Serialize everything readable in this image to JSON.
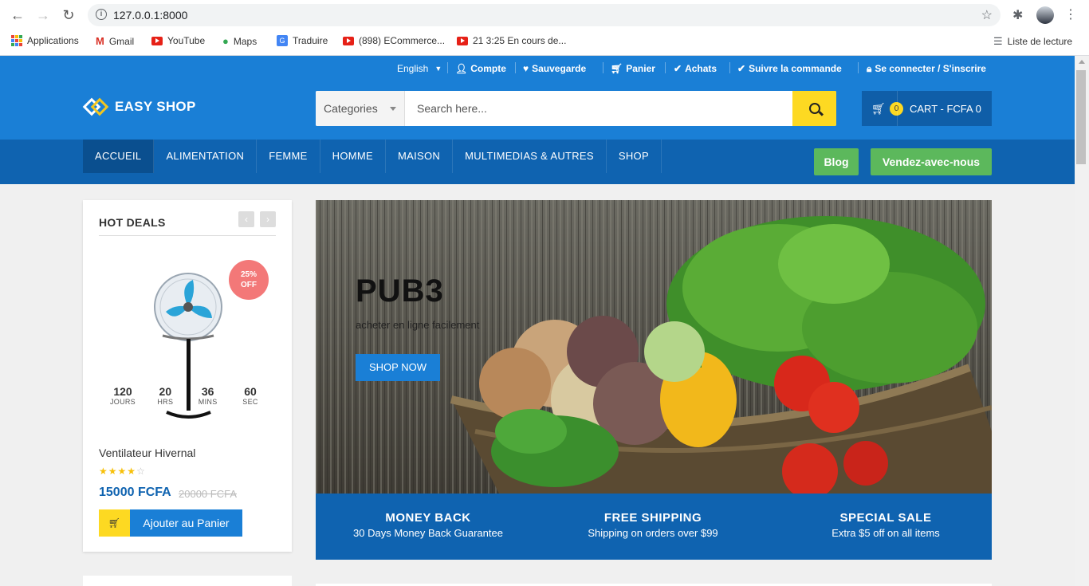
{
  "browser": {
    "url": "127.0.0.1:8000",
    "bookmarks": [
      {
        "label": "Applications"
      },
      {
        "label": "Gmail"
      },
      {
        "label": "YouTube"
      },
      {
        "label": "Maps"
      },
      {
        "label": "Traduire"
      },
      {
        "label": "(898) ECommerce..."
      },
      {
        "label": "21 3:25 En cours de..."
      }
    ],
    "reading_list": "Liste de lecture"
  },
  "topbar": {
    "language": "English",
    "links": [
      "Compte",
      "Sauvegarde",
      "Panier",
      "Achats",
      "Suivre la commande",
      "Se connecter / S'inscrire"
    ]
  },
  "logo": "EASY SHOP",
  "search": {
    "category": "Categories",
    "placeholder": "Search here..."
  },
  "cart": {
    "count": "0",
    "label": "CART - FCFA 0"
  },
  "menu": [
    "ACCUEIL",
    "ALIMENTATION",
    "FEMME",
    "HOMME",
    "MAISON",
    "MULTIMEDIAS & AUTRES",
    "SHOP"
  ],
  "menu_buttons": {
    "blog": "Blog",
    "sell": "Vendez-avec-nous"
  },
  "hot_deals": {
    "title": "HOT DEALS",
    "badge_line1": "25%",
    "badge_line2": "OFF",
    "countdown": [
      {
        "value": "120",
        "unit": "JOURS"
      },
      {
        "value": "20",
        "unit": "HRS"
      },
      {
        "value": "36",
        "unit": "MINS"
      },
      {
        "value": "60",
        "unit": "SEC"
      }
    ],
    "product_name": "Ventilateur Hivernal",
    "rating": 4,
    "rating_max": 5,
    "price": "15000 FCFA",
    "old_price": "20000 FCFA",
    "add_to_cart": "Ajouter au Panier"
  },
  "banner": {
    "title": "PUB3",
    "subtitle": "acheter en ligne facilement",
    "button": "SHOP NOW"
  },
  "features": [
    {
      "title": "MONEY BACK",
      "subtitle": "30 Days Money Back Guarantee"
    },
    {
      "title": "FREE SHIPPING",
      "subtitle": "Shipping on orders over $99"
    },
    {
      "title": "SPECIAL SALE",
      "subtitle": "Extra $5 off on all items"
    }
  ],
  "colors": {
    "primary": "#1a7fd6",
    "primary_dark": "#0f63b0",
    "accent_yellow": "#fdd922",
    "green": "#5cb85c",
    "badge": "#f37878"
  }
}
